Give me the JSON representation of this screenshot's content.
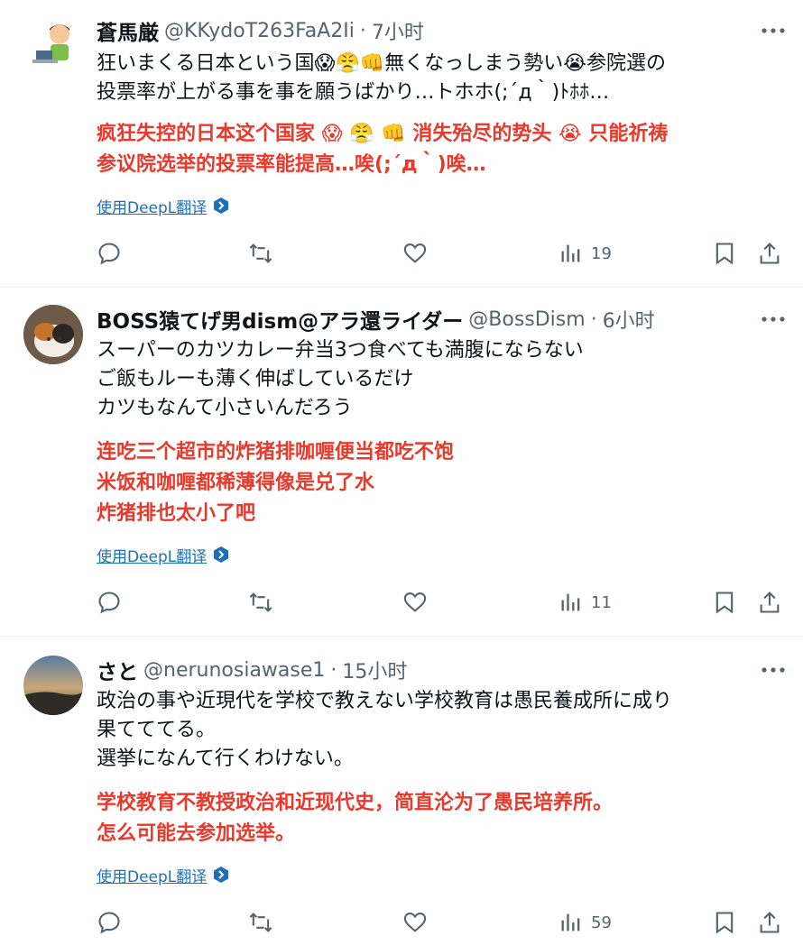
{
  "tweets": [
    {
      "name": "蒼馬厳",
      "handle": "@KKydoT263FaA2Ii",
      "time": "7小时",
      "ja_lines": [
        "狂いまくる日本という国😱😤👊無くなっしまう勢い😭参院選の",
        "投票率が上がる事を事を願うばかり…トホホ(;´д｀)ﾄﾎﾎ…"
      ],
      "cn_lines": [
        "疯狂失控的日本这个国家 😱 😤 👊 消失殆尽的势头 😭 只能祈祷",
        "参议院选举的投票率能提高…唉(;´д｀)唉…"
      ],
      "translate_label": "使用DeepL翻译",
      "views": "19"
    },
    {
      "name": "BOSS猿てげ男dism@アラ還ライダー",
      "handle": "@BossDism",
      "time": "6小时",
      "ja_lines": [
        "スーパーのカツカレー弁当3つ食べても満腹にならない",
        "ご飯もルーも薄く伸ばしているだけ",
        "カツもなんて小さいんだろう"
      ],
      "cn_lines": [
        "连吃三个超市的炸猪排咖喱便当都吃不饱",
        "米饭和咖喱都稀薄得像是兑了水",
        "炸猪排也太小了吧"
      ],
      "translate_label": "使用DeepL翻译",
      "views": "11"
    },
    {
      "name": "さと",
      "handle": "@nerunosiawase1",
      "time": "15小时",
      "ja_lines": [
        "政治の事や近現代を学校で教えない学校教育は愚民養成所に成り",
        "果てててる。",
        "選挙になんて行くわけない。"
      ],
      "cn_lines": [
        "学校教育不教授政治和近现代史，简直沦为了愚民培养所。",
        "怎么可能去参加选举。"
      ],
      "translate_label": "使用DeepL翻译",
      "views": "59"
    }
  ],
  "separator": "·",
  "icons": {
    "more": "more-icon",
    "reply": "reply-icon",
    "retweet": "retweet-icon",
    "like": "heart-icon",
    "views": "views-icon",
    "bookmark": "bookmark-icon",
    "share": "share-icon",
    "deepl": "deepl-icon"
  },
  "colors": {
    "translation_text": "#e8392b",
    "link": "#1d70b8",
    "secondary_text": "#536471"
  }
}
